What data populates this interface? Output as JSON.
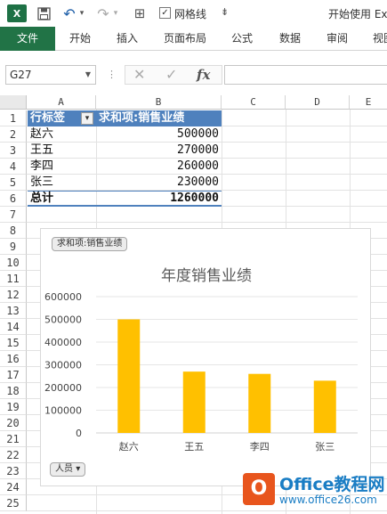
{
  "qat": {
    "app_logo": "X",
    "gridlines_check": "✓",
    "gridlines_label": "网格线",
    "more": "⇟",
    "window_title": "开始使用 Ex"
  },
  "ribbon": {
    "tabs": [
      "文件",
      "开始",
      "插入",
      "页面布局",
      "公式",
      "数据",
      "审阅",
      "视图"
    ]
  },
  "formula_bar": {
    "name_box": "G27",
    "formula": ""
  },
  "grid": {
    "columns": [
      "A",
      "B",
      "C",
      "D",
      "E"
    ],
    "rows": [
      "1",
      "2",
      "3",
      "4",
      "5",
      "6",
      "7",
      "8",
      "9",
      "10",
      "11",
      "12",
      "13",
      "14",
      "15",
      "16",
      "17",
      "18",
      "19",
      "20",
      "21",
      "22",
      "23",
      "24",
      "25"
    ]
  },
  "pivot": {
    "row_label_header": "行标签",
    "value_header": "求和项:销售业绩",
    "rows": [
      {
        "label": "赵六",
        "value": "500000"
      },
      {
        "label": "王五",
        "value": "270000"
      },
      {
        "label": "李四",
        "value": "260000"
      },
      {
        "label": "张三",
        "value": "230000"
      }
    ],
    "total_label": "总计",
    "total_value": "1260000"
  },
  "chart": {
    "value_field_button": "求和项:销售业绩",
    "axis_field_button": "人员"
  },
  "chart_data": {
    "type": "bar",
    "title": "年度销售业绩",
    "categories": [
      "赵六",
      "王五",
      "李四",
      "张三"
    ],
    "values": [
      500000,
      270000,
      260000,
      230000
    ],
    "ylim": [
      0,
      600000
    ],
    "yticks": [
      0,
      100000,
      200000,
      300000,
      400000,
      500000,
      600000
    ],
    "grid": true,
    "color": "#ffc000"
  },
  "watermark": {
    "logo_glyph": "O",
    "name": "Office教程网",
    "url": "www.office26.com"
  }
}
